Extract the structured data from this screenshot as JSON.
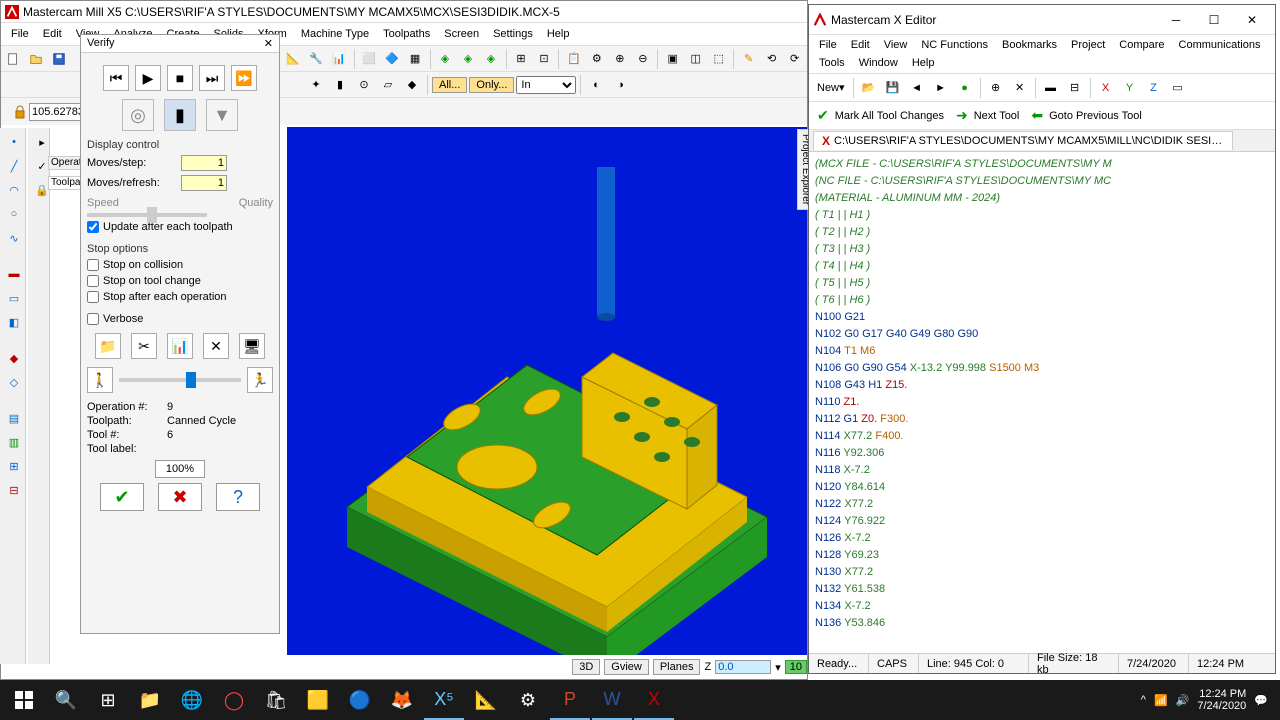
{
  "main": {
    "title": "Mastercam Mill X5  C:\\USERS\\RIF'A STYLES\\DOCUMENTS\\MY MCAMX5\\MCX\\SESI3DIDIK.MCX-5",
    "menu": [
      "File",
      "Edit",
      "View",
      "Analyze",
      "Create",
      "Solids",
      "Xform",
      "Machine Type",
      "Toolpaths",
      "Screen",
      "Settings",
      "Help"
    ],
    "coord": "105.62783",
    "operations_tab": "Operations",
    "toolpaths_tab": "Toolpaths"
  },
  "verify": {
    "title": "Verify",
    "display_control": "Display control",
    "moves_step": "Moves/step:",
    "moves_step_val": "1",
    "moves_refresh": "Moves/refresh:",
    "moves_refresh_val": "1",
    "speed": "Speed",
    "quality": "Quality",
    "update": "Update after each toolpath",
    "stop_options": "Stop options",
    "stop_collision": "Stop on collision",
    "stop_toolchange": "Stop on tool change",
    "stop_each_op": "Stop after each operation",
    "verbose": "Verbose",
    "op_num_label": "Operation #:",
    "op_num": "9",
    "toolpath_label": "Toolpath:",
    "toolpath": "Canned Cycle",
    "tool_num_label": "Tool #:",
    "tool_num": "6",
    "tool_label_label": "Tool label:",
    "progress": "100%"
  },
  "bottom": {
    "b3d": "3D",
    "gview": "Gview",
    "planes": "Planes",
    "z_label": "Z",
    "z_val": "0.0",
    "count": "10"
  },
  "editor": {
    "title": "Mastercam X Editor",
    "menu": [
      "File",
      "Edit",
      "View",
      "NC Functions",
      "Bookmarks",
      "Project",
      "Compare",
      "Communications",
      "Tools",
      "Window",
      "Help"
    ],
    "new_btn": "New",
    "mark": "Mark All Tool Changes",
    "next": "Next Tool",
    "prev": "Goto Previous Tool",
    "tab": "C:\\USERS\\RIF'A STYLES\\DOCUMENTS\\MY MCAMX5\\MILL\\NC\\DIDIK SESI3 SEBEL...",
    "code": [
      {
        "t": "(MCX FILE - C:\\USERS\\RIF'A STYLES\\DOCUMENTS\\MY M",
        "cls": "cmt"
      },
      {
        "t": "(NC FILE - C:\\USERS\\RIF'A STYLES\\DOCUMENTS\\MY MC",
        "cls": "cmt"
      },
      {
        "t": "(MATERIAL - ALUMINUM MM - 2024)",
        "cls": "cmt"
      },
      {
        "t": "( T1 | | H1 )",
        "cls": "cmt"
      },
      {
        "t": "( T2 | | H2 )",
        "cls": "cmt"
      },
      {
        "t": "( T3 | | H3 )",
        "cls": "cmt"
      },
      {
        "t": "( T4 | | H4 )",
        "cls": "cmt"
      },
      {
        "t": "( T5 | | H5 )",
        "cls": "cmt"
      },
      {
        "t": "( T6 | | H6 )",
        "cls": "cmt"
      },
      {
        "t": "N100 G21",
        "cls": "blu"
      },
      {
        "t": "N102 G0 G17 G40 G49 G80 G90",
        "cls": "blu"
      },
      {
        "t": "N104 <span class='org'>T1 M6</span>",
        "raw": true
      },
      {
        "t": "N106 <span class='blu'>G0 G90 G54</span> <span class='grn'>X-13.2 Y99.998</span> <span class='org'>S1500 M3</span>",
        "raw": true
      },
      {
        "t": "N108 <span class='blu'>G43 H1</span> <span class='red'>Z15.</span>",
        "raw": true
      },
      {
        "t": "N110 <span class='red'>Z1.</span>",
        "raw": true
      },
      {
        "t": "N112 <span class='blu'>G1</span> <span class='red'>Z0.</span> <span class='org'>F300.</span>",
        "raw": true
      },
      {
        "t": "N114 <span class='grn'>X77.2</span> <span class='org'>F400.</span>",
        "raw": true
      },
      {
        "t": "N116 Y92.306",
        "cls": "grn"
      },
      {
        "t": "N118 X-7.2",
        "cls": "grn"
      },
      {
        "t": "N120 Y84.614",
        "cls": "grn"
      },
      {
        "t": "N122 X77.2",
        "cls": "grn"
      },
      {
        "t": "N124 Y76.922",
        "cls": "grn"
      },
      {
        "t": "N126 X-7.2",
        "cls": "grn"
      },
      {
        "t": "N128 Y69.23",
        "cls": "grn"
      },
      {
        "t": "N130 X77.2",
        "cls": "grn"
      },
      {
        "t": "N132 Y61.538",
        "cls": "grn"
      },
      {
        "t": "N134 X-7.2",
        "cls": "grn"
      },
      {
        "t": "N136 Y53.846",
        "cls": "grn"
      }
    ],
    "status": {
      "ready": "Ready...",
      "caps": "CAPS",
      "line": "Line: 945 Col: 0",
      "size": "File Size: 18 kb",
      "date": "7/24/2020",
      "time": "12:24 PM"
    }
  },
  "taskbar": {
    "time": "12:24 PM",
    "date": "7/24/2020"
  },
  "pexplorer": "Project Explorer"
}
